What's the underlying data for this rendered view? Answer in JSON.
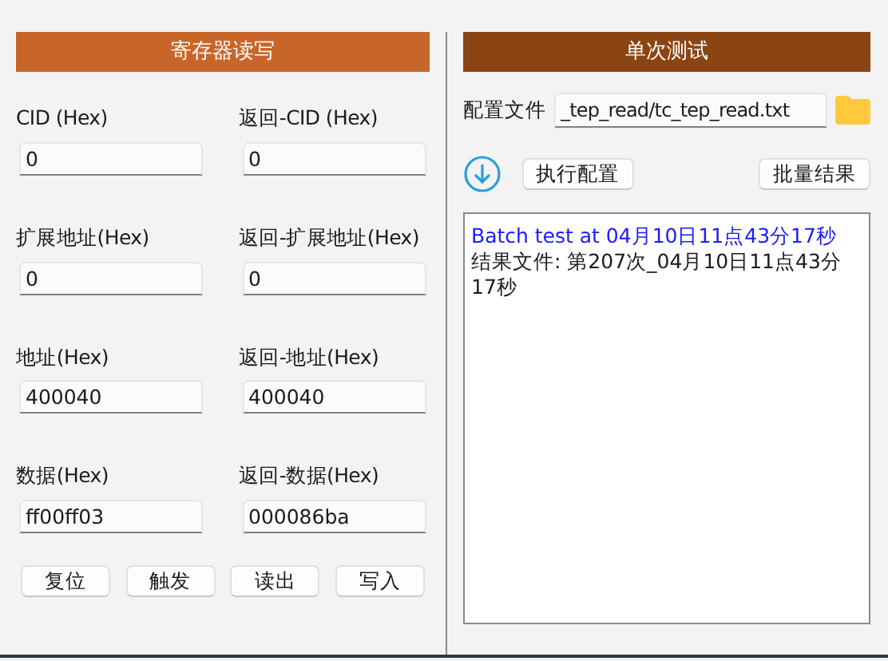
{
  "register_panel": {
    "title": "寄存器读写",
    "fields": [
      {
        "label": "CID (Hex)",
        "value": "0"
      },
      {
        "label": "返回-CID (Hex)",
        "value": "0"
      },
      {
        "label": "扩展地址(Hex)",
        "value": "0"
      },
      {
        "label": "返回-扩展地址(Hex)",
        "value": "0"
      },
      {
        "label": "地址(Hex)",
        "value": "400040"
      },
      {
        "label": "返回-地址(Hex)",
        "value": "400040"
      },
      {
        "label": "数据(Hex)",
        "value": "ff00ff03"
      },
      {
        "label": "返回-数据(Hex)",
        "value": "000086ba"
      }
    ],
    "buttons": [
      "复位",
      "触发",
      "读出",
      "写入"
    ]
  },
  "single_test_panel": {
    "title": "单次测试",
    "config_label": "配置文件",
    "config_file": "_tep_read/tc_tep_read.txt",
    "run_button": "执行配置",
    "batch_button": "批量结果",
    "log": [
      {
        "text": "Batch test at 04月10日11点43分17秒",
        "color": "#1a1aff"
      },
      {
        "text": "结果文件: 第207次_04月10日11点43分17秒",
        "color": "#1a1a1a"
      }
    ]
  }
}
